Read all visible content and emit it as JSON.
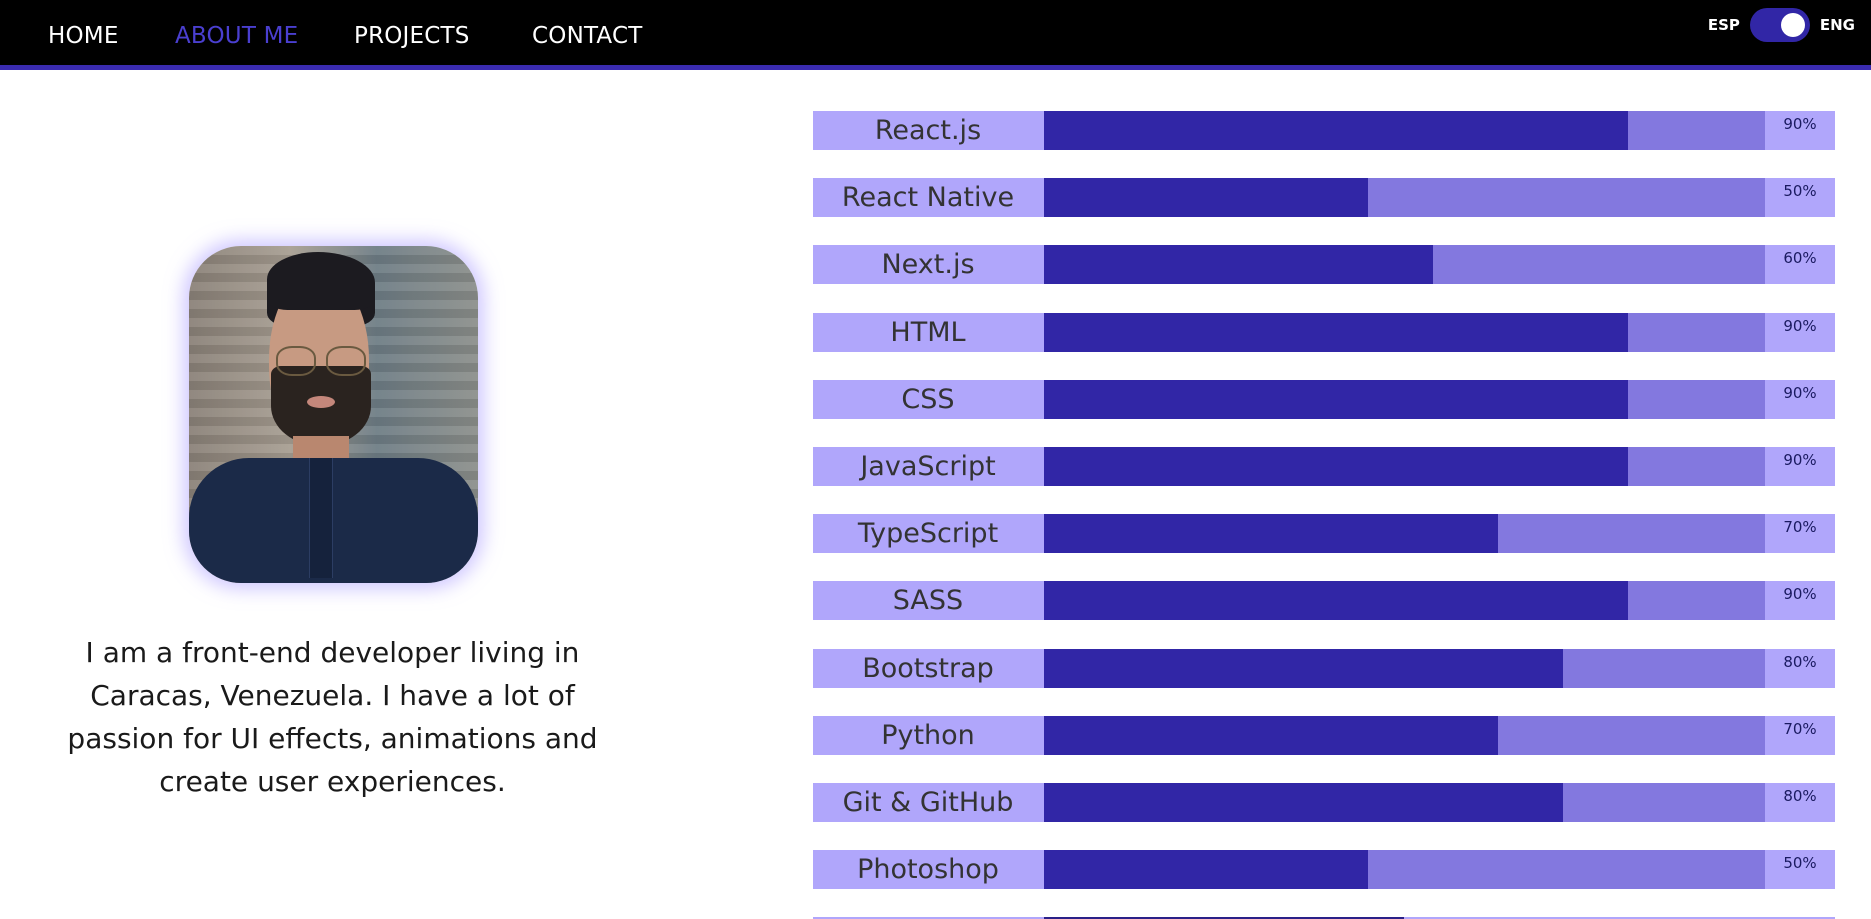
{
  "nav": {
    "links": [
      {
        "label": "HOME",
        "active": false
      },
      {
        "label": "ABOUT ME",
        "active": true
      },
      {
        "label": "PROJECTS",
        "active": false
      },
      {
        "label": "CONTACT",
        "active": false
      }
    ],
    "lang_left": "ESP",
    "lang_right": "ENG",
    "lang_selected": "ENG"
  },
  "about": {
    "bio": "I am a front-end developer living in Caracas, Venezuela. I have a lot of passion for UI effects, animations and create user experiences."
  },
  "skills": [
    {
      "name": "React.js",
      "percent_label": "90%",
      "level": 0.9
    },
    {
      "name": "React Native",
      "percent_label": "50%",
      "level": 0.5
    },
    {
      "name": "Next.js",
      "percent_label": "60%",
      "level": 0.6
    },
    {
      "name": "HTML",
      "percent_label": "90%",
      "level": 0.9
    },
    {
      "name": "CSS",
      "percent_label": "90%",
      "level": 0.9
    },
    {
      "name": "JavaScript",
      "percent_label": "90%",
      "level": 0.9
    },
    {
      "name": "TypeScript",
      "percent_label": "70%",
      "level": 0.7
    },
    {
      "name": "SASS",
      "percent_label": "90%",
      "level": 0.9
    },
    {
      "name": "Bootstrap",
      "percent_label": "80%",
      "level": 0.8
    },
    {
      "name": "Python",
      "percent_label": "70%",
      "level": 0.7
    },
    {
      "name": "Git & GitHub",
      "percent_label": "80%",
      "level": 0.8
    },
    {
      "name": "Photoshop",
      "percent_label": "50%",
      "level": 0.5
    }
  ],
  "colors": {
    "nav_bg": "#000000",
    "accent": "#3126a6",
    "active_link": "#4a3fd0",
    "skill_row_bg": "#b0a6fb",
    "track_bg": "#8378df"
  }
}
